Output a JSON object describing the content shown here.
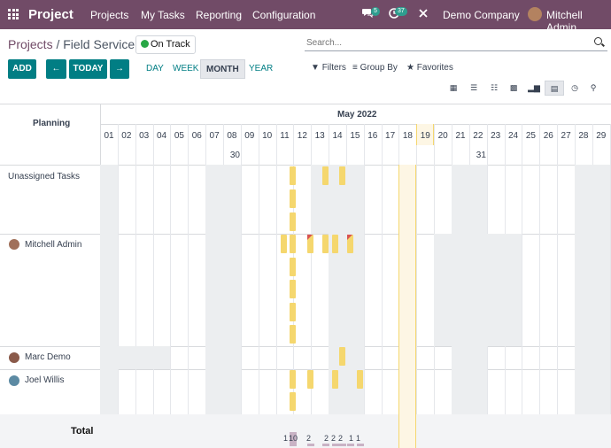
{
  "navbar": {
    "brand": "Project",
    "menu": [
      "Projects",
      "My Tasks",
      "Reporting",
      "Configuration"
    ],
    "messages_count": "5",
    "activities_count": "37",
    "company": "Demo Company",
    "user": "Mitchell Admin"
  },
  "breadcrumb": {
    "parent": "Projects",
    "separator": "/",
    "current": "Field Service"
  },
  "status": "On Track",
  "search": {
    "placeholder": "Search..."
  },
  "toolbar": {
    "add": "ADD",
    "prev": "←",
    "today": "TODAY",
    "next": "→",
    "scales": [
      "DAY",
      "WEEK",
      "MONTH",
      "YEAR"
    ],
    "active_scale": "MONTH",
    "filters": "Filters",
    "group_by": "Group By",
    "favorites": "Favorites"
  },
  "views": [
    "kanban-icon",
    "list-icon",
    "calendar-icon",
    "pivot-icon",
    "graph-icon",
    "gantt-icon",
    "activity-icon",
    "map-icon"
  ],
  "gantt": {
    "header_label": "Planning",
    "month": "May 2022",
    "days": [
      "01",
      "02",
      "03",
      "04",
      "05",
      "06",
      "07",
      "08",
      "09",
      "10",
      "11",
      "12",
      "13",
      "14",
      "15",
      "16",
      "17",
      "18",
      "19",
      "20",
      "21",
      "22",
      "23",
      "24",
      "25",
      "26",
      "27",
      "28",
      "29"
    ],
    "weeks": [
      "30",
      "31"
    ],
    "today": "19",
    "rows": [
      {
        "name": "Unassigned Tasks"
      },
      {
        "name": "Mitchell Admin"
      },
      {
        "name": "Marc Demo"
      },
      {
        "name": "Joel Willis"
      }
    ],
    "total_label": "Total",
    "totals": [
      "1",
      "10",
      "2",
      "2",
      "2",
      "2",
      "1",
      "1"
    ]
  }
}
